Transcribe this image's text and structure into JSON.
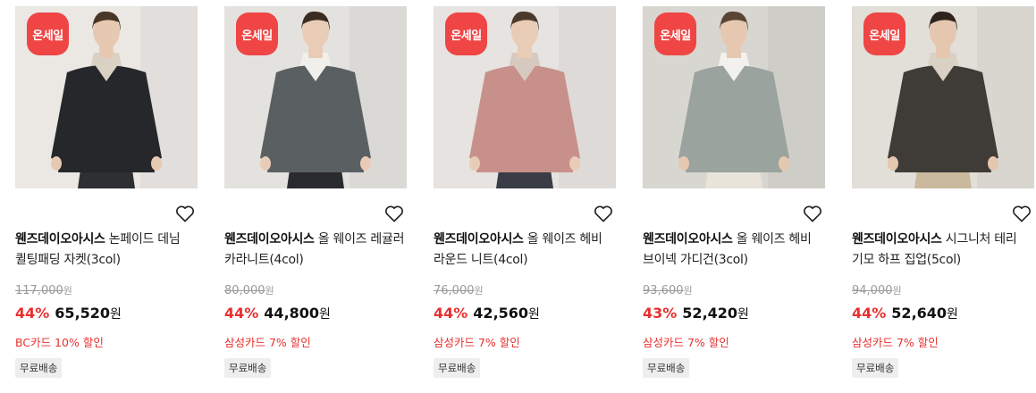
{
  "products": [
    {
      "badge": "온세일",
      "brand": "웬즈데이오아시스",
      "name": "논페이드 데님 퀼팅패딩 자켓(3col)",
      "original_price": "117,000",
      "discount_rate": "44%",
      "sale_price": "65,520",
      "currency": "원",
      "card_discount": "BC카드 10% 할인",
      "shipping": "무료배송",
      "colors": {
        "bg": "#ebe8e4",
        "garment": "#26272a",
        "inner": "#d9d2c4",
        "pants": "#2d2f33",
        "skin": "#e7c9b2",
        "hair": "#4a3628"
      }
    },
    {
      "badge": "온세일",
      "brand": "웬즈데이오아시스",
      "name": "올 웨이즈 레귤러 카라니트(4col)",
      "original_price": "80,000",
      "discount_rate": "44%",
      "sale_price": "44,800",
      "currency": "원",
      "card_discount": "삼성카드 7% 할인",
      "shipping": "무료배송",
      "colors": {
        "bg": "#e4e2df",
        "garment": "#5a6062",
        "inner": "#f1efec",
        "pants": "#2a2b2f",
        "skin": "#e8ccb6",
        "hair": "#3b2c22"
      }
    },
    {
      "badge": "온세일",
      "brand": "웬즈데이오아시스",
      "name": "올 웨이즈 헤비 라운드 니트(4col)",
      "original_price": "76,000",
      "discount_rate": "44%",
      "sale_price": "42,560",
      "currency": "원",
      "card_discount": "삼성카드 7% 할인",
      "shipping": "무료배송",
      "colors": {
        "bg": "#e6e3e0",
        "garment": "#c8908a",
        "inner": "#d6c9c0",
        "pants": "#3a3d45",
        "skin": "#e8ccb6",
        "hair": "#4b3a2c"
      }
    },
    {
      "badge": "온세일",
      "brand": "웬즈데이오아시스",
      "name": "올 웨이즈 헤비 브이넥 가디건(3col)",
      "original_price": "93,600",
      "discount_rate": "43%",
      "sale_price": "52,420",
      "currency": "원",
      "card_discount": "삼성카드 7% 할인",
      "shipping": "무료배송",
      "colors": {
        "bg": "#d8d6d0",
        "garment": "#9aa39d",
        "inner": "#f2f1ee",
        "pants": "#e9e4da",
        "skin": "#e6c8b0",
        "hair": "#5a4434"
      }
    },
    {
      "badge": "온세일",
      "brand": "웬즈데이오아시스",
      "name": "시그니처 테리 기모 하프 집업(5col)",
      "original_price": "94,000",
      "discount_rate": "44%",
      "sale_price": "52,640",
      "currency": "원",
      "card_discount": "삼성카드 7% 할인",
      "shipping": "무료배송",
      "colors": {
        "bg": "#e2ded8",
        "garment": "#3f3c38",
        "inner": "#d8d1c4",
        "pants": "#cbb99d",
        "skin": "#e5c6ae",
        "hair": "#2f241d"
      }
    }
  ]
}
